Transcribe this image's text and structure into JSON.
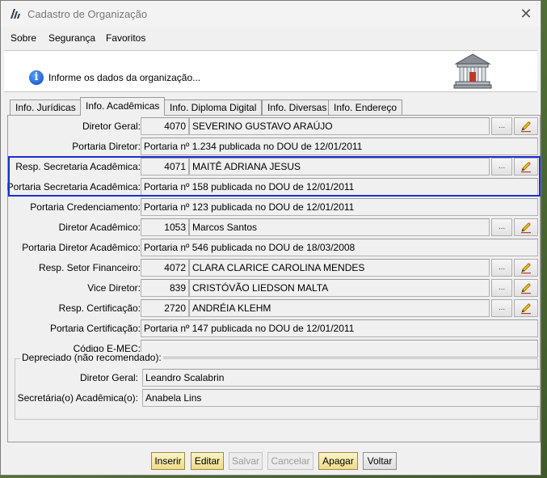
{
  "window": {
    "title": "Cadastro de Organização"
  },
  "menu": {
    "items": [
      "Sobre",
      "Segurança",
      "Favoritos"
    ]
  },
  "header": {
    "message": "Informe os dados da organização..."
  },
  "tabs": [
    {
      "label": "Info. Jurídicas"
    },
    {
      "label": "Info. Acadêmicas"
    },
    {
      "label": "Info. Diploma Digital"
    },
    {
      "label": "Info. Diversas"
    },
    {
      "label": "Info. Endereço"
    }
  ],
  "active_tab": "Info. Acadêmicas",
  "form": {
    "diretor_geral": {
      "label": "Diretor Geral:",
      "code": "4070",
      "name": "SEVERINO GUSTAVO ARAÚJO"
    },
    "portaria_diretor": {
      "label": "Portaria Diretor:",
      "value": "Portaria nº 1.234 publicada no DOU de 12/01/2011"
    },
    "resp_secretaria": {
      "label": "Resp. Secretaria Acadêmica:",
      "code": "4071",
      "name": "MAITÊ ADRIANA JESUS"
    },
    "portaria_secretaria": {
      "label": "Portaria Secretaria Acadêmica:",
      "value": "Portaria nº 158 publicada no DOU de 12/01/2011"
    },
    "portaria_credenciamento": {
      "label": "Portaria Credenciamento:",
      "value": "Portaria nº 123 publicada no DOU de 12/01/2011"
    },
    "diretor_academico": {
      "label": "Diretor Acadêmico:",
      "code": "1053",
      "name": "Marcos Santos"
    },
    "portaria_diretor_academico": {
      "label": "Portaria Diretor Acadêmico:",
      "value": "Portaria nº 546 publicada no DOU de 18/03/2008"
    },
    "resp_setor_financeiro": {
      "label": "Resp. Setor Financeiro:",
      "code": "4072",
      "name": "CLARA CLARICE CAROLINA MENDES"
    },
    "vice_diretor": {
      "label": "Vice Diretor:",
      "code": "839",
      "name": "CRISTÓVÃO LIEDSON MALTA"
    },
    "resp_certificacao": {
      "label": "Resp. Certificação:",
      "code": "2720",
      "name": "ANDRÉIA KLEHM"
    },
    "portaria_certificacao": {
      "label": "Portaria Certificação:",
      "value": "Portaria nº 147 publicada no DOU de 12/01/2011"
    },
    "codigo_emec": {
      "label": "Código E-MEC:",
      "value": ""
    }
  },
  "deprecated": {
    "title": "Depreciado (não recomendado):",
    "diretor_geral": {
      "label": "Diretor Geral:",
      "value": "Leandro Scalabrin"
    },
    "secretaria": {
      "label": "Secretária(o) Acadêmica(o):",
      "value": "Anabela Lins"
    }
  },
  "buttons": {
    "inserir": "Inserir",
    "editar": "Editar",
    "salvar": "Salvar",
    "cancelar": "Cancelar",
    "apagar": "Apagar",
    "voltar": "Voltar"
  },
  "lookup_button_text": "...",
  "colors": {
    "highlight": "#1a2fd0",
    "yellow_button": "#f3e6a3",
    "info": "#1a5ad8"
  }
}
